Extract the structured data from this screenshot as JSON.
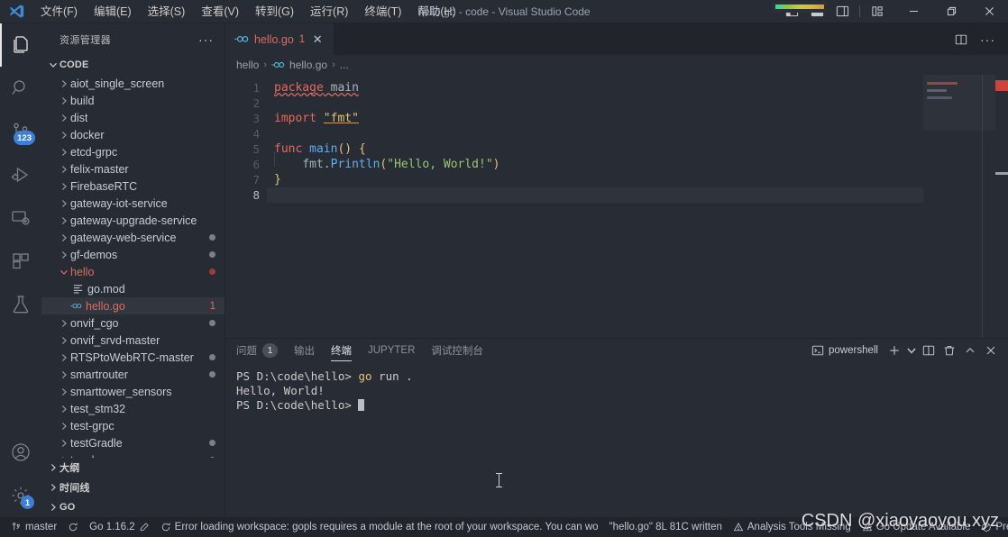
{
  "titlebar": {
    "title": "hello.go - code - Visual Studio Code",
    "menu": [
      "文件(F)",
      "编辑(E)",
      "选择(S)",
      "查看(V)",
      "转到(G)",
      "运行(R)",
      "终端(T)",
      "帮助(H)"
    ]
  },
  "activitybar": {
    "items": [
      {
        "name": "explorer",
        "badge": ""
      },
      {
        "name": "search",
        "badge": ""
      },
      {
        "name": "source-control",
        "badge": "123"
      },
      {
        "name": "run-and-debug",
        "badge": ""
      },
      {
        "name": "remote-explorer",
        "badge": ""
      },
      {
        "name": "extensions",
        "badge": ""
      },
      {
        "name": "testing",
        "badge": ""
      }
    ],
    "bottom": [
      {
        "name": "accounts",
        "badge": ""
      },
      {
        "name": "settings",
        "badge": "1"
      }
    ]
  },
  "sidebar": {
    "header": "资源管理器",
    "menu_dots": "···",
    "root": "CODE",
    "items": [
      {
        "label": "aiot_single_screen",
        "type": "folder",
        "dot": false
      },
      {
        "label": "build",
        "type": "folder",
        "dot": false
      },
      {
        "label": "dist",
        "type": "folder",
        "dot": false
      },
      {
        "label": "docker",
        "type": "folder",
        "dot": false
      },
      {
        "label": "etcd-grpc",
        "type": "folder",
        "dot": false
      },
      {
        "label": "felix-master",
        "type": "folder",
        "dot": false
      },
      {
        "label": "FirebaseRTC",
        "type": "folder",
        "dot": false
      },
      {
        "label": "gateway-iot-service",
        "type": "folder",
        "dot": false
      },
      {
        "label": "gateway-upgrade-service",
        "type": "folder",
        "dot": false
      },
      {
        "label": "gateway-web-service",
        "type": "folder",
        "dot": true
      },
      {
        "label": "gf-demos",
        "type": "folder",
        "dot": true
      },
      {
        "label": "hello",
        "type": "folder-open",
        "dot": true,
        "error": true
      },
      {
        "label": "go.mod",
        "type": "file-mod",
        "dot": false
      },
      {
        "label": "hello.go",
        "type": "file-go",
        "dot": false,
        "error": true,
        "count": "1",
        "selected": true
      },
      {
        "label": "onvif_cgo",
        "type": "folder",
        "dot": true
      },
      {
        "label": "onvif_srvd-master",
        "type": "folder",
        "dot": false
      },
      {
        "label": "RTSPtoWebRTC-master",
        "type": "folder",
        "dot": true
      },
      {
        "label": "smartrouter",
        "type": "folder",
        "dot": true
      },
      {
        "label": "smarttower_sensors",
        "type": "folder",
        "dot": false
      },
      {
        "label": "test_stm32",
        "type": "folder",
        "dot": false
      },
      {
        "label": "test-grpc",
        "type": "folder",
        "dot": false
      },
      {
        "label": "testGradle",
        "type": "folder",
        "dot": true
      },
      {
        "label": "touch",
        "type": "folder",
        "dot": true
      }
    ],
    "sections": [
      "大纲",
      "时间线",
      "GO"
    ]
  },
  "editor": {
    "tab": {
      "label": "hello.go",
      "count": "1",
      "close": "✕"
    },
    "breadcrumb": [
      "hello",
      "hello.go",
      "..."
    ],
    "lines": [
      "1",
      "2",
      "3",
      "4",
      "5",
      "6",
      "7",
      "8"
    ],
    "active_line": "8",
    "code": {
      "l1_kw": "package",
      "l1_name": "main",
      "l3_kw": "import",
      "l3_str": "\"fmt\"",
      "l5_kw": "func",
      "l5_name": "main",
      "l5_parens": "()",
      "l5_brace": "{",
      "l6_pkg": "fmt",
      "l6_dot": ".",
      "l6_fn": "Println",
      "l6_open": "(",
      "l6_str": "\"Hello, World!\"",
      "l6_close": ")",
      "l7_brace": "}"
    }
  },
  "panel": {
    "tabs": [
      {
        "label": "问题",
        "badge": "1",
        "active": false
      },
      {
        "label": "输出",
        "badge": "",
        "active": false
      },
      {
        "label": "终端",
        "badge": "",
        "active": true
      },
      {
        "label": "JUPYTER",
        "badge": "",
        "active": false
      },
      {
        "label": "调试控制台",
        "badge": "",
        "active": false
      }
    ],
    "shell": "powershell",
    "actions": [
      "new-terminal",
      "terminal-dropdown",
      "split-terminal",
      "kill-terminal",
      "maximize-panel",
      "close-panel"
    ],
    "terminal": {
      "line1_prompt": "PS D:\\code\\hello> ",
      "line1_cmd": "go",
      "line1_args": " run .",
      "line2": "Hello, World!",
      "line3_prompt": "PS D:\\code\\hello> "
    }
  },
  "statusbar": {
    "branch": "master",
    "sync": "sync-icon",
    "go_version": "Go 1.16.2",
    "error_text": "Error loading workspace: gopls requires a module at the root of your workspace. You can wo",
    "file_written": "\"hello.go\" 8L 81C written",
    "analysis": "Analysis Tools Missing",
    "go_update": "Go Update Available",
    "prettier": "Prettier"
  },
  "watermark": "CSDN @xiaoyaoyou.xyz",
  "colors": {
    "accent_blue": "#3d7fd6",
    "error_red": "#e06c5d",
    "bg": "#282c34",
    "sidebar_bg": "#272b33",
    "titlebar_bg": "#282c34"
  }
}
